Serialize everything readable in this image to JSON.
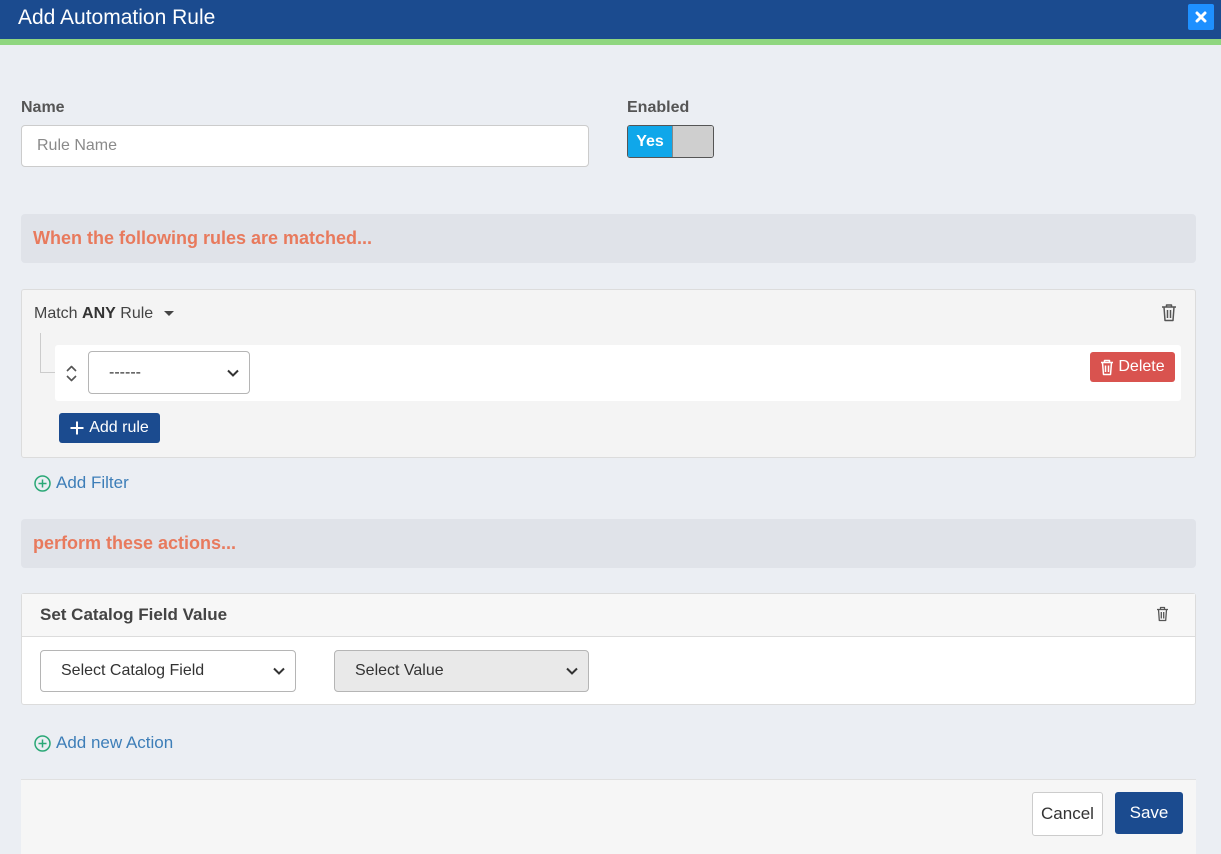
{
  "dialog": {
    "title": "Add Automation Rule",
    "close_icon": "close-icon"
  },
  "form": {
    "name_label": "Name",
    "name_placeholder": "Rule Name",
    "name_value": "",
    "enabled_label": "Enabled",
    "enabled_on_text": "Yes",
    "enabled": true
  },
  "conditions": {
    "header": "When the following rules are matched...",
    "match_prefix": "Match",
    "match_mode": "ANY",
    "match_suffix": "Rule",
    "rule_select_value": "------",
    "delete_label": "Delete",
    "add_rule_label": "Add rule",
    "add_filter_label": "Add Filter"
  },
  "actions": {
    "header": "perform these actions...",
    "action_title": "Set Catalog Field Value",
    "catalog_field_select": "Select Catalog Field",
    "value_select": "Select Value",
    "add_action_label": "Add new Action"
  },
  "footer": {
    "cancel_label": "Cancel",
    "save_label": "Save"
  },
  "colors": {
    "title_bar": "#1b4b8f",
    "accent_strip": "#8fd67f",
    "section_header_text": "#e87a5d",
    "toggle_on": "#0fa7ea",
    "delete_button": "#d9534f",
    "primary_button": "#1b4b8f",
    "link": "#3d7eb8",
    "add_icon": "#2aa876"
  }
}
